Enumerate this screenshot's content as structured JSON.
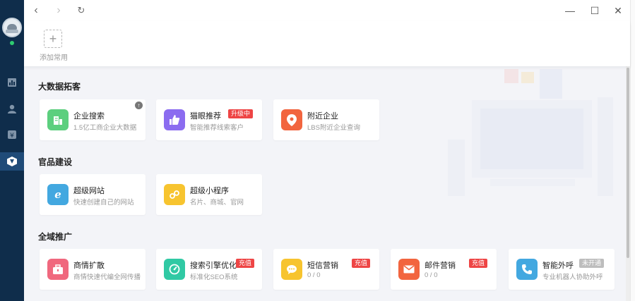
{
  "quickbar": {
    "add_label": "添加常用"
  },
  "sections": [
    {
      "title": "大数据拓客"
    },
    {
      "title": "官品建设"
    },
    {
      "title": "全域推广"
    }
  ],
  "cards": {
    "enterprise_search": {
      "name": "企业搜索",
      "desc": "1.5亿工商企业大数据"
    },
    "smart_recommend": {
      "name": "猫眼推荐",
      "badge": "升级中",
      "desc": "智能推荐线索客户"
    },
    "nearby": {
      "name": "附近企业",
      "desc": "LBS附近企业查询"
    },
    "super_site": {
      "name": "超级网站",
      "desc": "快速创建自己的网站"
    },
    "mini_program": {
      "name": "超级小程序",
      "desc": "名片、商城、官网"
    },
    "biz_expand": {
      "name": "商情扩散",
      "desc": "商情快速代编全网传播"
    },
    "seo": {
      "name": "搜索引擎优化",
      "badge": "充值",
      "desc": "标准化SEO系统"
    },
    "sms": {
      "name": "短信营销",
      "badge": "充值",
      "desc": "0 / 0"
    },
    "email": {
      "name": "邮件营销",
      "badge": "充值",
      "desc": "0 / 0"
    },
    "ai_call": {
      "name": "智能外呼",
      "badge": "未开通",
      "desc": "专业机器人协助外呼"
    }
  },
  "colors": {
    "sidebar": "#0f2d4b",
    "green": "#5ccf7e",
    "purple": "#8b6cf0",
    "orange": "#f2653f",
    "blue": "#43a8e0",
    "yellow": "#f7c42f",
    "pink": "#f0687e",
    "teal": "#30c9a4",
    "badge_red": "#ee4545"
  },
  "icons": {
    "sidebar": [
      "chart-icon",
      "user-icon",
      "yen-icon",
      "cube-icon"
    ],
    "nav": [
      "back-icon",
      "forward-icon",
      "refresh-icon"
    ],
    "window": [
      "minimize-icon",
      "maximize-icon",
      "close-icon"
    ]
  }
}
